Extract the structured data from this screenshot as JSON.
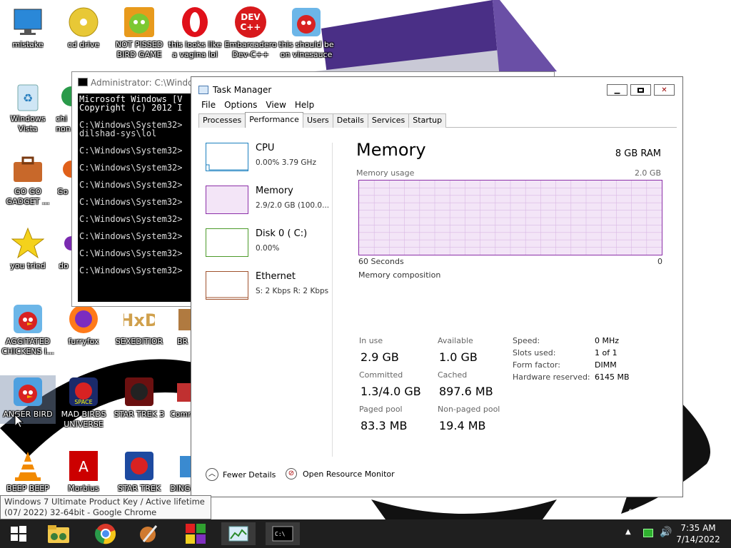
{
  "desktop": {
    "icons": [
      {
        "label": "mistake"
      },
      {
        "label": "cd drive"
      },
      {
        "label": "NOT PISSED BIRD GAME"
      },
      {
        "label": "this looks like a vagina lol"
      },
      {
        "label": "Embarcadero Dev-C++"
      },
      {
        "label": "this should be on vinesauce"
      },
      {
        "label": "Windows Vista"
      },
      {
        "label": "GO GO GADGET ..."
      },
      {
        "label": "you tried"
      },
      {
        "label": "AGGITATED CHICKENS I..."
      },
      {
        "label": "furryfox"
      },
      {
        "label": "SEXEDITIOR"
      },
      {
        "label": "ANGER BIRD"
      },
      {
        "label": "MAD BIRDS UNIVERSE"
      },
      {
        "label": "STAR TREK 3"
      },
      {
        "label": "BEEP BEEP"
      },
      {
        "label": "Morbius"
      },
      {
        "label": "STAR TREK"
      }
    ],
    "partial_labels": {
      "ch": "chi",
      "non": "non",
      "go": "Go",
      "do": "do",
      "br": "BR",
      "com": "Comr",
      "ding": "DING",
      "windows_text": "f Windows"
    }
  },
  "cmd": {
    "title": "Administrator: C:\\Windo",
    "lines": [
      "Microsoft Windows [V",
      "Copyright (c) 2012 I",
      "",
      "C:\\Windows\\System32>",
      "dilshad-sys\\lol",
      "",
      "C:\\Windows\\System32>",
      "",
      "C:\\Windows\\System32>",
      "",
      "C:\\Windows\\System32>",
      "",
      "C:\\Windows\\System32>",
      "",
      "C:\\Windows\\System32>",
      "",
      "C:\\Windows\\System32>",
      "",
      "C:\\Windows\\System32>",
      "",
      "C:\\Windows\\System32>"
    ]
  },
  "taskmanager": {
    "title": "Task Manager",
    "menu": [
      "File",
      "Options",
      "View",
      "Help"
    ],
    "tabs": [
      "Processes",
      "Performance",
      "Users",
      "Details",
      "Services",
      "Startup"
    ],
    "active_tab": "Performance",
    "sidebar": [
      {
        "name": "CPU",
        "value": "0.00%  3.79 GHz",
        "color": "#1a7fbf"
      },
      {
        "name": "Memory",
        "value": "2.9/2.0 GB (100.0...",
        "color": "#8b2fa8"
      },
      {
        "name": "Disk 0 ( C:)",
        "value": "0.00%",
        "color": "#4c9a2a"
      },
      {
        "name": "Ethernet",
        "value": "S: 2 Kbps R: 2 Kbps",
        "color": "#a0522d"
      }
    ],
    "memory": {
      "heading": "Memory",
      "total": "8 GB RAM",
      "usage_label": "Memory usage",
      "usage_max": "2.0 GB",
      "axis_left": "60 Seconds",
      "axis_right": "0",
      "composition_label": "Memory composition",
      "usage_fill_percent": 100,
      "stats": [
        {
          "label": "In use",
          "value": "2.9 GB"
        },
        {
          "label": "Available",
          "value": "1.0 GB"
        },
        {
          "label": "Committed",
          "value": "1.3/4.0 GB"
        },
        {
          "label": "Cached",
          "value": "897.6 MB"
        },
        {
          "label": "Paged pool",
          "value": "83.3 MB"
        },
        {
          "label": "Non-paged pool",
          "value": "19.4 MB"
        }
      ],
      "specs": [
        {
          "label": "Speed:",
          "value": "0 MHz"
        },
        {
          "label": "Slots used:",
          "value": "1 of 1"
        },
        {
          "label": "Form factor:",
          "value": "DIMM"
        },
        {
          "label": "Hardware reserved:",
          "value": "6145 MB"
        }
      ]
    },
    "footer": {
      "fewer": "Fewer Details",
      "monitor": "Open Resource Monitor"
    }
  },
  "tooltip": {
    "text": "Windows 7 Ultimate Product Key / Active lifetime (07/ 2022) 32-64bit - Google Chrome"
  },
  "taskbar": {
    "time": "7:35 AM",
    "date": "7/14/2022"
  }
}
